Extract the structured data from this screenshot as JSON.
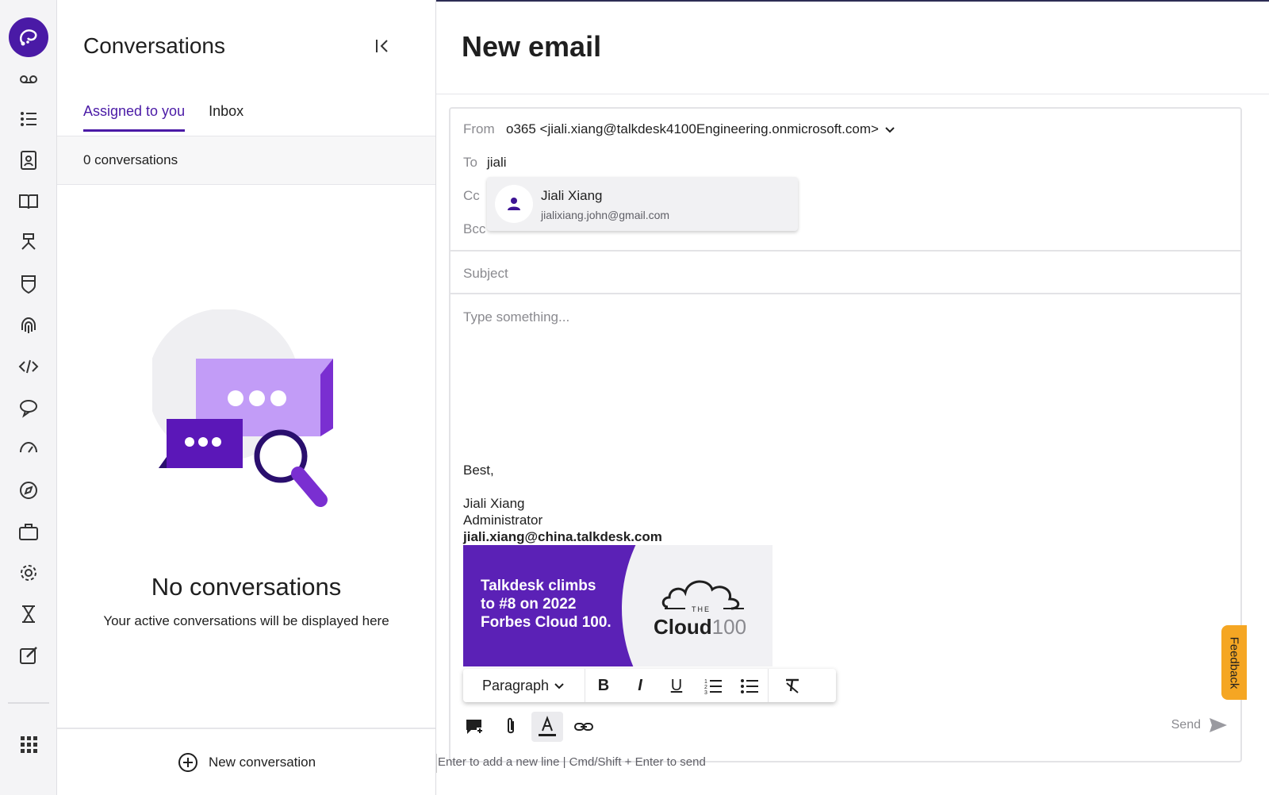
{
  "conversations": {
    "title": "Conversations",
    "tabs": [
      {
        "label": "Assigned to you",
        "active": true
      },
      {
        "label": "Inbox",
        "active": false
      }
    ],
    "count": "0 conversations",
    "empty_title": "No conversations",
    "empty_subtitle": "Your active conversations will be displayed here",
    "new_conversation": "New conversation"
  },
  "email": {
    "title": "New email",
    "labels": {
      "from": "From",
      "to": "To",
      "cc": "Cc",
      "bcc": "Bcc"
    },
    "from_value": "o365 <jiali.xiang@talkdesk4100Engineering.onmicrosoft.com>",
    "to_value": "jiali",
    "suggestion": {
      "name": "Jiali Xiang",
      "email": "jialixiang.john@gmail.com"
    },
    "subject_placeholder": "Subject",
    "body_placeholder": "Type something...",
    "signature": {
      "greeting": "Best,",
      "name": "Jiali Xiang",
      "role": "Administrator",
      "email": "jiali.xiang@china.talkdesk.com"
    },
    "banner": {
      "line1": "Talkdesk climbs",
      "line2": "to #8 on 2022",
      "line3": "Forbes Cloud 100.",
      "logo_the": "THE",
      "logo_cloud": "Cloud",
      "logo_100": "100"
    },
    "format_block": "Paragraph",
    "send": "Send",
    "hint": "Enter to add a new line | Cmd/Shift + Enter to send",
    "feedback": "Feedback"
  },
  "colors": {
    "brand": "#4a1aa6",
    "banner_purple": "#5b21b6",
    "feedback": "#f5a623"
  },
  "rail_icons": [
    "voicemail-icon",
    "list-icon",
    "contacts-icon",
    "knowledge-icon",
    "flow-icon",
    "shield-icon",
    "fingerprint-icon",
    "code-icon",
    "chat-icon",
    "dashboard-icon",
    "compass-icon",
    "briefcase-icon",
    "settings-icon",
    "hourglass-icon",
    "compose-icon",
    "apps-icon"
  ]
}
